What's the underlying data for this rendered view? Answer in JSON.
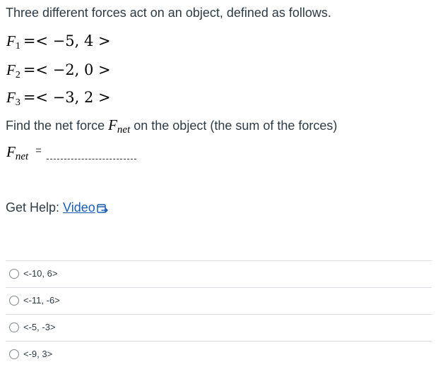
{
  "question": {
    "intro": "Three different forces act on an object, defined as follows.",
    "forces": [
      {
        "symbol": "F",
        "subscript": "1",
        "vector": "=< −5, 4 >"
      },
      {
        "symbol": "F",
        "subscript": "2",
        "vector": "=< −2, 0 >"
      },
      {
        "symbol": "F",
        "subscript": "3",
        "vector": "=< −3, 2 >"
      }
    ],
    "prompt_before": "Find the net force ",
    "prompt_symbol": "F",
    "prompt_subscript": "net",
    "prompt_after": " on the object (the sum of the forces)",
    "answer_symbol": "F",
    "answer_subscript": "net",
    "answer_equals": "="
  },
  "help": {
    "label": "Get Help: ",
    "link_text": "Video"
  },
  "choices": [
    {
      "label": "<-10, 6>"
    },
    {
      "label": "<-11, -6>"
    },
    {
      "label": "<-5, -3>"
    },
    {
      "label": "<-9, 3>"
    }
  ],
  "colors": {
    "text": "#2d3b45",
    "link": "#1a5fb4",
    "divider": "#d9dde1"
  }
}
